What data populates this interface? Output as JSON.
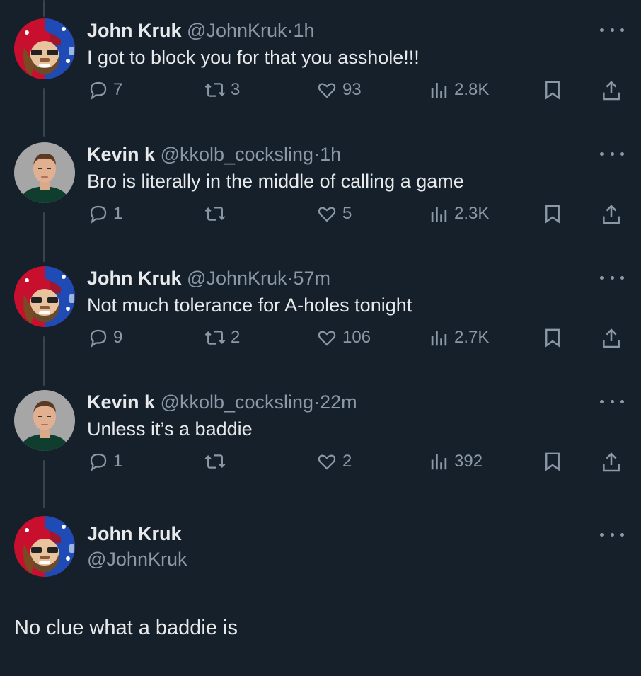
{
  "tweets": [
    {
      "name": "John Kruk",
      "handle": "@JohnKruk",
      "time": "1h",
      "text": "I got to block you for that you asshole!!!",
      "replies": "7",
      "retweets": "3",
      "likes": "93",
      "views": "2.8K"
    },
    {
      "name": "Kevin k",
      "handle": "@kkolb_cocksling",
      "time": "1h",
      "text": "Bro is literally in the middle of calling a game",
      "replies": "1",
      "retweets": "",
      "likes": "5",
      "views": "2.3K"
    },
    {
      "name": "John Kruk",
      "handle": "@JohnKruk",
      "time": "57m",
      "text": "Not much tolerance for A-holes tonight",
      "replies": "9",
      "retweets": "2",
      "likes": "106",
      "views": "2.7K"
    },
    {
      "name": "Kevin k",
      "handle": "@kkolb_cocksling",
      "time": "22m",
      "text": "Unless it’s a baddie",
      "replies": "1",
      "retweets": "",
      "likes": "2",
      "views": "392"
    }
  ],
  "main": {
    "name": "John Kruk",
    "handle": "@JohnKruk",
    "text": "No clue what a baddie is"
  },
  "separator": "·",
  "colors": {
    "background": "#15202b",
    "text": "#e7e9ea",
    "muted": "#8b98a5",
    "thread_line": "#38444d"
  },
  "icons": [
    "reply-icon",
    "retweet-icon",
    "like-icon",
    "views-icon",
    "bookmark-icon",
    "share-icon",
    "more-icon"
  ]
}
